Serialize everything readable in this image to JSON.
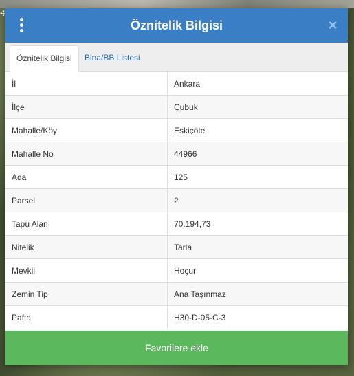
{
  "dialog": {
    "title": "Öznitelik Bilgisi",
    "close_symbol": "×",
    "menu_icon": "vertical-dots-icon"
  },
  "tabs": [
    {
      "label": "Öznitelik Bilgisi",
      "active": true
    },
    {
      "label": "Bina/BB Listesi",
      "active": false
    }
  ],
  "attributes": [
    {
      "key": "İl",
      "value": "Ankara"
    },
    {
      "key": "İlçe",
      "value": "Çubuk"
    },
    {
      "key": "Mahalle/Köy",
      "value": "Eskiçöte"
    },
    {
      "key": "Mahalle No",
      "value": "44966"
    },
    {
      "key": "Ada",
      "value": "125"
    },
    {
      "key": "Parsel",
      "value": "2"
    },
    {
      "key": "Tapu Alanı",
      "value": "70.194,73"
    },
    {
      "key": "Nitelik",
      "value": "Tarla"
    },
    {
      "key": "Mevkii",
      "value": "Hoçur"
    },
    {
      "key": "Zemin Tip",
      "value": "Ana Taşınmaz"
    },
    {
      "key": "Pafta",
      "value": "H30-D-05-C-3"
    }
  ],
  "footer": {
    "favorite_button_label": "Favorilere ekle"
  },
  "colors": {
    "header": "#3a7ec6",
    "favorite_button": "#5cb85c",
    "tab_link": "#2a6db5"
  }
}
